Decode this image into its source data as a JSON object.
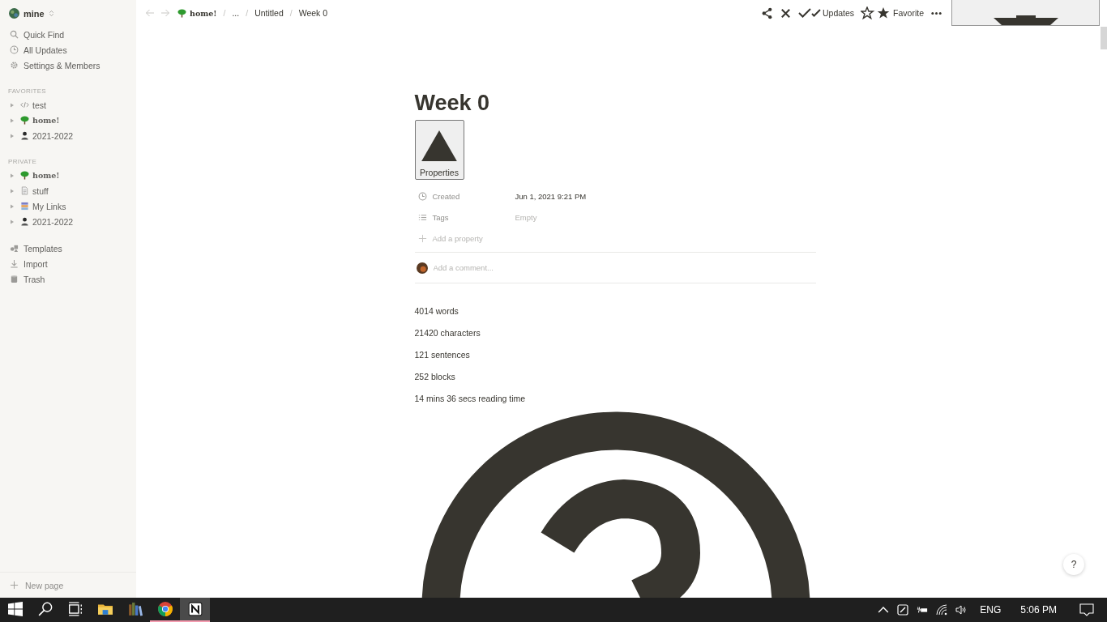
{
  "workspace": {
    "name": "mine"
  },
  "nav": [
    {
      "kind": "search",
      "label": "Quick Find"
    },
    {
      "kind": "clock",
      "label": "All Updates"
    },
    {
      "kind": "gear",
      "label": "Settings & Members"
    }
  ],
  "sections": [
    {
      "heading": "FAVORITES",
      "items": [
        {
          "kind": "code",
          "label": "test",
          "fancy": false
        },
        {
          "kind": "tree",
          "label": "home!",
          "fancy": true
        },
        {
          "kind": "person",
          "label": "2021-2022",
          "fancy": false
        }
      ]
    },
    {
      "heading": "PRIVATE",
      "items": [
        {
          "kind": "tree",
          "label": "home!",
          "fancy": true
        },
        {
          "kind": "doc",
          "label": "stuff",
          "fancy": false
        },
        {
          "kind": "links",
          "label": "My Links",
          "fancy": false
        },
        {
          "kind": "person",
          "label": "2021-2022",
          "fancy": false
        }
      ]
    }
  ],
  "tools": [
    {
      "kind": "templates",
      "label": "Templates"
    },
    {
      "kind": "import",
      "label": "Import"
    },
    {
      "kind": "trash",
      "label": "Trash"
    }
  ],
  "new_page": "New page",
  "breadcrumbs": [
    {
      "kind": "tree",
      "label": "home!",
      "fancy": true
    },
    {
      "kind": "separator",
      "label": "/",
      "fancy": false
    },
    {
      "kind": "text",
      "label": "...",
      "fancy": false
    },
    {
      "kind": "separator",
      "label": "/",
      "fancy": false
    },
    {
      "kind": "text",
      "label": "Untitled",
      "fancy": false
    },
    {
      "kind": "separator",
      "label": "/",
      "fancy": false
    },
    {
      "kind": "text",
      "label": "Week 0",
      "fancy": false
    }
  ],
  "actions": {
    "updates": "Updates",
    "favorite": "Favorite"
  },
  "page": {
    "title": "Week 0",
    "properties_button": "Properties",
    "properties": [
      {
        "kind": "clock",
        "name": "Created",
        "value": "Jun 1, 2021 9:21 PM",
        "empty": false
      },
      {
        "kind": "list",
        "name": "Tags",
        "value": "Empty",
        "empty": true
      }
    ],
    "add_property": "Add a property",
    "comment_placeholder": "Add a comment...",
    "stats": [
      "4014 words",
      "21420 characters",
      "121 sentences",
      "252 blocks",
      "14 mins 36 secs reading time"
    ]
  },
  "help": "?",
  "taskbar": {
    "apps": [
      {
        "kind": "start",
        "selected": false,
        "running": false
      },
      {
        "kind": "search",
        "selected": false,
        "running": false
      },
      {
        "kind": "taskview",
        "selected": false,
        "running": false
      },
      {
        "kind": "folder",
        "selected": false,
        "running": false
      },
      {
        "kind": "books",
        "selected": false,
        "running": false
      },
      {
        "kind": "chrome",
        "selected": false,
        "running": true
      },
      {
        "kind": "notion",
        "selected": true,
        "running": true
      }
    ],
    "language": "ENG",
    "time": "5:06 PM"
  }
}
